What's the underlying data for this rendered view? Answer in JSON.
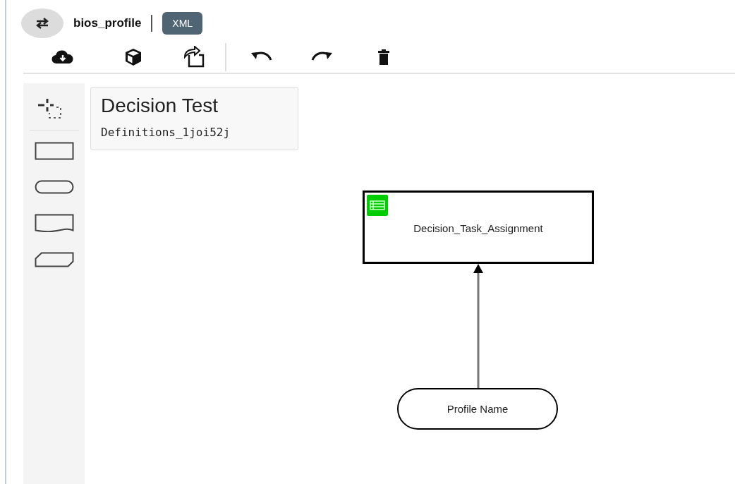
{
  "header": {
    "title": "bios_profile",
    "format_badge": "XML"
  },
  "definition_card": {
    "name": "Decision Test",
    "id": "Definitions_1joi52j"
  },
  "diagram": {
    "nodes": [
      {
        "kind": "decision",
        "label": "Decision_Task_Assignment"
      },
      {
        "kind": "input",
        "label": "Profile Name"
      }
    ]
  }
}
